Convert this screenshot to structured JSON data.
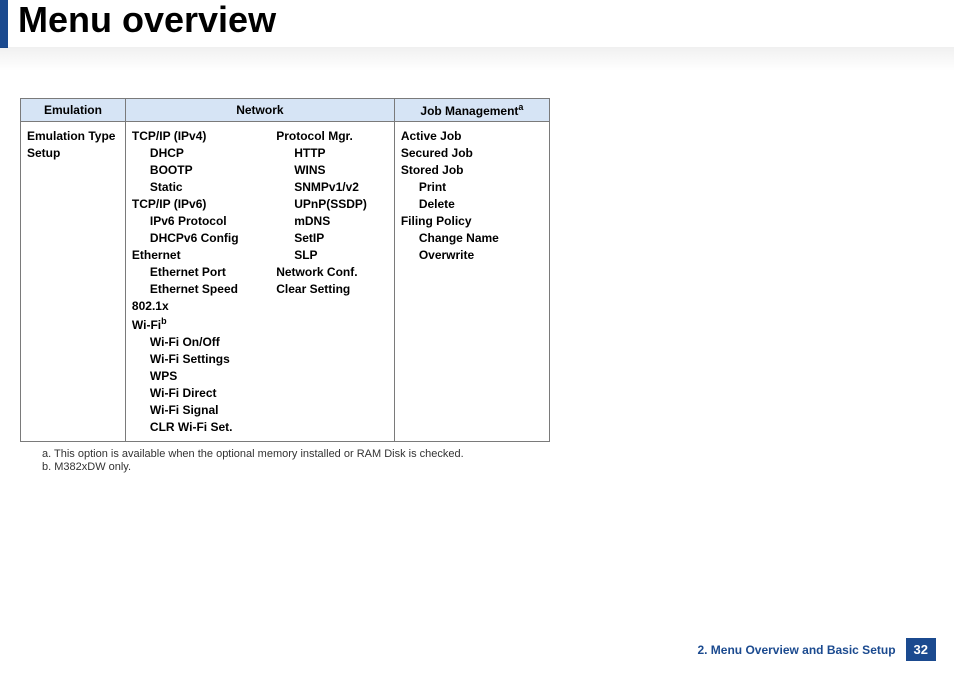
{
  "title": "Menu overview",
  "columns": {
    "emulation": "Emulation",
    "network": "Network",
    "job_management": "Job Management",
    "job_management_sup": "a"
  },
  "emulation": {
    "type": "Emulation Type",
    "setup": "Setup"
  },
  "network_col1": {
    "tcpip4": "TCP/IP (IPv4)",
    "dhcp": "DHCP",
    "bootp": "BOOTP",
    "static": "Static",
    "tcpip6": "TCP/IP (IPv6)",
    "ipv6proto": "IPv6 Protocol",
    "dhcpv6": "DHCPv6 Config",
    "ethernet": "Ethernet",
    "ethport": "Ethernet Port",
    "ethspeed": "Ethernet Speed",
    "dot1x": "802.1x",
    "wifi": "Wi-Fi",
    "wifi_sup": "b",
    "wifionoff": "Wi-Fi On/Off",
    "wifisettings": "Wi-Fi Settings",
    "wps": "WPS",
    "wifidirect": "Wi-Fi Direct",
    "wifisignal": "Wi-Fi Signal",
    "clrwifi": "CLR Wi-Fi Set."
  },
  "network_col2": {
    "protomgr": "Protocol Mgr.",
    "http": "HTTP",
    "wins": "WINS",
    "snmp": "SNMPv1/v2",
    "upnp": "UPnP(SSDP)",
    "mdns": "mDNS",
    "setip": "SetIP",
    "slp": "SLP",
    "netconf": "Network Conf.",
    "clearsetting": "Clear Setting"
  },
  "job_mgmt": {
    "active": "Active Job",
    "secured": "Secured Job",
    "stored": "Stored Job",
    "print": "Print",
    "delete": "Delete",
    "filing": "Filing Policy",
    "changename": "Change Name",
    "overwrite": "Overwrite"
  },
  "footnotes": {
    "a": "a.  This option is available when the optional memory installed or RAM Disk is checked.",
    "b": "b.  M382xDW only."
  },
  "footer": {
    "chapter": "2. Menu Overview and Basic Setup",
    "page": "32"
  }
}
